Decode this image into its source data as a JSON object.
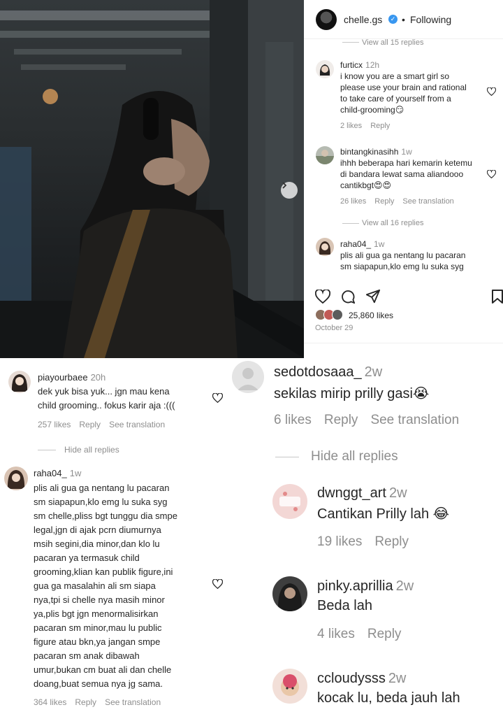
{
  "post": {
    "username": "chelle.gs",
    "verified_mark": "✓",
    "dot": "•",
    "follow_status": "Following",
    "view_replies_1": "View all 15 replies",
    "view_replies_2": "View all 16 replies",
    "likes": "25,860 likes",
    "date": "October 29",
    "comments": [
      {
        "user": "furticx",
        "time": "12h",
        "lines": [
          "i know you are a smart girl so",
          "please use your brain and rational",
          "to take care of yourself from a",
          "child-grooming😏"
        ],
        "likes": "2 likes",
        "reply": "Reply"
      },
      {
        "user": "bintangkinasihh",
        "time": "1w",
        "lines": [
          "ihhh beberapa hari kemarin ketemu",
          "di bandara lewat sama aliandooo",
          "cantikbgt😍😍"
        ],
        "likes": "26 likes",
        "reply": "Reply",
        "translate": "See translation"
      },
      {
        "user": "raha04_",
        "time": "1w",
        "lines": [
          "plis ali gua ga nentang lu pacaran",
          "sm siapapun,klo emg lu suka syg"
        ]
      }
    ]
  },
  "left_comments": {
    "c1": {
      "user": "piayourbaee",
      "time": "20h",
      "lines": [
        "dek yuk bisa yuk... jgn mau kena",
        "child grooming.. fokus karir aja :((("
      ],
      "likes": "257 likes",
      "reply": "Reply",
      "translate": "See translation"
    },
    "hide_replies": "Hide all replies",
    "c2": {
      "user": "raha04_",
      "time": "1w",
      "lines": [
        "plis ali gua ga nentang lu pacaran",
        "sm siapapun,klo emg lu suka syg",
        "sm chelle,pliss bgt tunggu dia smpe",
        "legal,jgn di ajak pcrn diumurnya",
        "msih segini,dia minor,dan klo lu",
        "pacaran ya termasuk child",
        "grooming,klian kan publik figure,ini",
        "gua ga masalahin ali sm siapa",
        "nya,tpi si chelle nya masih minor",
        "ya,plis bgt jgn menormalisirkan",
        "pacaran sm minor,mau lu public",
        "figure atau bkn,ya jangan smpe",
        "pacaran sm anak dibawah",
        "umur,bukan cm buat ali dan chelle",
        "doang,buat semua nya jg sama."
      ],
      "likes": "364 likes",
      "reply": "Reply",
      "translate": "See translation"
    }
  },
  "right_comments": {
    "c1": {
      "user": "sedotdosaaa_",
      "time": "2w",
      "text": "sekilas mirip prilly gasi😭",
      "likes": "6 likes",
      "reply": "Reply",
      "translate": "See translation"
    },
    "hide_replies": "Hide all replies",
    "c2": {
      "user": "dwnggt_art",
      "time": "2w",
      "text": "Cantikan Prilly lah 😂",
      "likes": "19 likes",
      "reply": "Reply"
    },
    "c3": {
      "user": "pinky.aprillia",
      "time": "2w",
      "text": "Beda lah",
      "likes": "4 likes",
      "reply": "Reply"
    },
    "c4": {
      "user": "ccloudysss",
      "time": "2w",
      "text": "kocak lu, beda jauh lah"
    }
  },
  "colors": {
    "text": "#262626",
    "muted": "#8e8e8e",
    "verified": "#3897f0",
    "divider": "#efefef"
  },
  "icons": [
    "heart-icon",
    "comment-icon",
    "share-icon",
    "bookmark-icon",
    "chevron-right-icon",
    "verified-icon"
  ]
}
